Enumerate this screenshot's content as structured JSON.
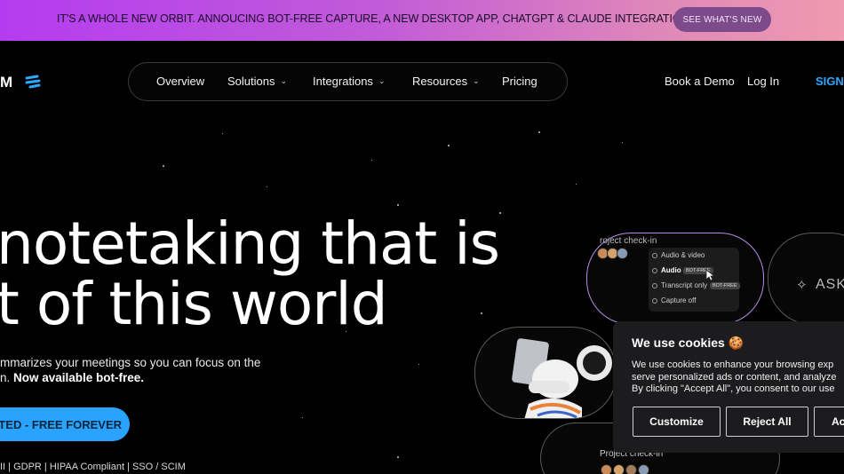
{
  "banner": {
    "text": "IT'S A WHOLE NEW ORBIT. ANNOUCING BOT-FREE CAPTURE, A NEW DESKTOP APP, CHATGPT & CLAUDE INTEGRATIONS & MORE",
    "button": "SEE WHAT'S NEW"
  },
  "nav": {
    "logo": "M",
    "items": [
      {
        "label": "Overview"
      },
      {
        "label": "Solutions"
      },
      {
        "label": "Integrations"
      },
      {
        "label": "Resources"
      },
      {
        "label": "Pricing"
      }
    ],
    "book_demo": "Book a Demo",
    "login": "Log In",
    "signup": "SIGN"
  },
  "hero": {
    "line1": "notetaking that is",
    "line2": "t of this world",
    "sub1": "mmarizes your meetings so you can focus on the",
    "sub2_prefix": "n. ",
    "sub2_bold": "Now available bot-free.",
    "cta": "RTED - FREE FOREVER",
    "compliance": "II  |  GDPR  |  HIPAA Compliant  |  SSO / SCIM"
  },
  "cards": {
    "card1_title": "roject check-in",
    "menu": [
      {
        "label": "Audio & video"
      },
      {
        "label": "Audio",
        "badge": "BOT-FREE"
      },
      {
        "label": "Transcript only",
        "badge": "BOT-FREE"
      },
      {
        "label": "Capture off"
      }
    ],
    "ask": "ASK",
    "card4_title": "Project check-in"
  },
  "cookie": {
    "title": "We use cookies",
    "emoji": "🍪",
    "body": "We use cookies to enhance your browsing exp\nserve personalized ads or content, and analyze\nBy clicking \"Accept All\", you consent to our use",
    "customize": "Customize",
    "reject": "Reject All",
    "accept": "Ac"
  },
  "colors": {
    "accent": "#29a3ff",
    "banner_start": "#b43cf0",
    "banner_end": "#ef9ab0"
  }
}
